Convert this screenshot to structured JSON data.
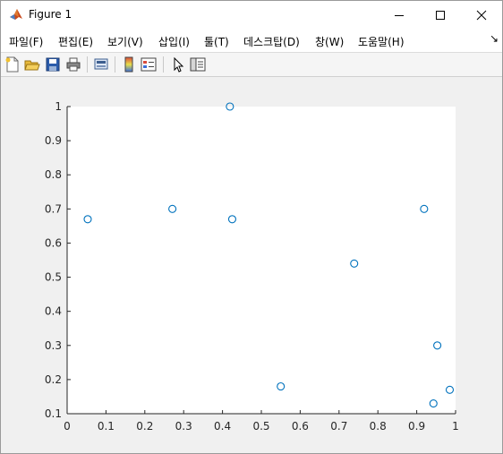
{
  "window": {
    "title": "Figure 1"
  },
  "menu": [
    {
      "label": "파일(F)"
    },
    {
      "label": "편집(E)"
    },
    {
      "label": "보기(V)"
    },
    {
      "label": "삽입(I)"
    },
    {
      "label": "툴(T)"
    },
    {
      "label": "데스크탑(D)"
    },
    {
      "label": "창(W)"
    },
    {
      "label": "도움말(H)"
    }
  ],
  "toolbar": {
    "icons": [
      "new-figure-icon",
      "open-file-icon",
      "save-icon",
      "print-icon",
      "link-figure-icon",
      "insert-colorbar-icon",
      "insert-legend-icon",
      "edit-plot-icon",
      "property-inspector-icon"
    ]
  },
  "chart_data": {
    "type": "scatter",
    "marker": "open-circle",
    "marker_color": "#0072BD",
    "xlim": [
      0,
      1
    ],
    "ylim": [
      0.1,
      1
    ],
    "x_ticks": [
      0,
      0.1,
      0.2,
      0.3,
      0.4,
      0.5,
      0.6,
      0.7,
      0.8,
      0.9,
      1
    ],
    "y_ticks": [
      0.1,
      0.2,
      0.3,
      0.4,
      0.5,
      0.6,
      0.7,
      0.8,
      0.9,
      1
    ],
    "x_tick_labels": [
      "0",
      "0.1",
      "0.2",
      "0.3",
      "0.4",
      "0.5",
      "0.6",
      "0.7",
      "0.8",
      "0.9",
      "1"
    ],
    "y_tick_labels": [
      "0.1",
      "0.2",
      "0.3",
      "0.4",
      "0.5",
      "0.6",
      "0.7",
      "0.8",
      "0.9",
      "1"
    ],
    "grid": false,
    "points": [
      {
        "x": 0.053,
        "y": 0.67
      },
      {
        "x": 0.271,
        "y": 0.7
      },
      {
        "x": 0.419,
        "y": 1.0
      },
      {
        "x": 0.425,
        "y": 0.67
      },
      {
        "x": 0.55,
        "y": 0.18
      },
      {
        "x": 0.739,
        "y": 0.54
      },
      {
        "x": 0.919,
        "y": 0.7
      },
      {
        "x": 0.943,
        "y": 0.13
      },
      {
        "x": 0.953,
        "y": 0.3
      },
      {
        "x": 0.985,
        "y": 0.17
      }
    ]
  }
}
